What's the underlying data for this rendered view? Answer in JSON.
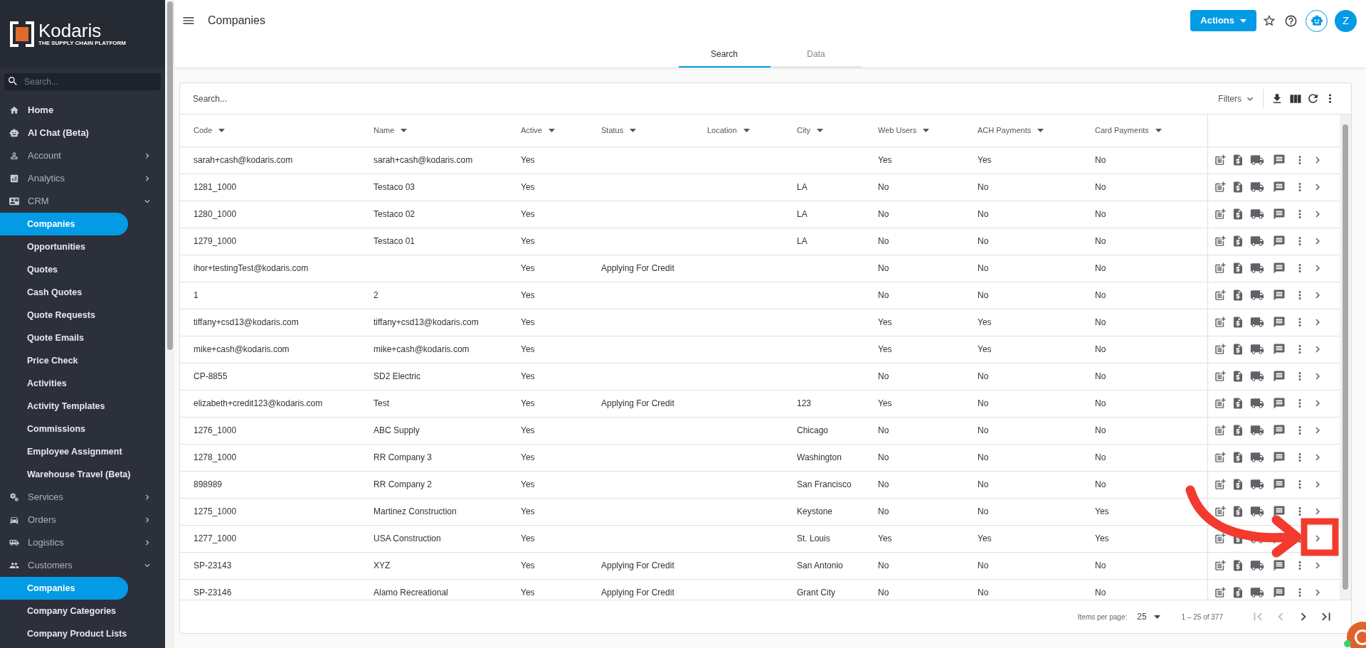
{
  "logo": {
    "name": "Kodaris",
    "tagline": "THE SUPPLY CHAIN PLATFORM"
  },
  "sidebar": {
    "search_placeholder": "Search...",
    "items": [
      {
        "kind": "link",
        "label": "Home"
      },
      {
        "kind": "link",
        "label": "AI Chat (Beta)"
      },
      {
        "kind": "group",
        "label": "Account",
        "expanded": false
      },
      {
        "kind": "group",
        "label": "Analytics",
        "expanded": false
      },
      {
        "kind": "group",
        "label": "CRM",
        "expanded": true,
        "children": [
          {
            "label": "Companies",
            "selected": true
          },
          {
            "label": "Opportunities",
            "selected": false
          },
          {
            "label": "Quotes",
            "selected": false
          },
          {
            "label": "Cash Quotes",
            "selected": false
          },
          {
            "label": "Quote Requests",
            "selected": false
          },
          {
            "label": "Quote Emails",
            "selected": false
          },
          {
            "label": "Price Check",
            "selected": false
          },
          {
            "label": "Activities",
            "selected": false
          },
          {
            "label": "Activity Templates",
            "selected": false
          },
          {
            "label": "Commissions",
            "selected": false
          },
          {
            "label": "Employee Assignment",
            "selected": false
          },
          {
            "label": "Warehouse Travel (Beta)",
            "selected": false
          }
        ]
      },
      {
        "kind": "group",
        "label": "Services",
        "expanded": false
      },
      {
        "kind": "group",
        "label": "Orders",
        "expanded": false
      },
      {
        "kind": "group",
        "label": "Logistics",
        "expanded": false
      },
      {
        "kind": "group",
        "label": "Customers",
        "expanded": true,
        "children": [
          {
            "label": "Companies",
            "selected": true
          },
          {
            "label": "Company Categories",
            "selected": false
          },
          {
            "label": "Company Product Lists",
            "selected": false
          }
        ]
      }
    ]
  },
  "header": {
    "title": "Companies",
    "actions_button": "Actions",
    "avatar": "Z"
  },
  "tabs": [
    {
      "label": "Search",
      "selected": true
    },
    {
      "label": "Data",
      "selected": false
    }
  ],
  "table": {
    "search_placeholder": "Search...",
    "filters": "Filters",
    "columns": [
      "Code",
      "Name",
      "Active",
      "Status",
      "Location",
      "City",
      "Web Users",
      "ACH Payments",
      "Card Payments"
    ],
    "rows": [
      [
        "sarah+cash@kodaris.com",
        "sarah+cash@kodaris.com",
        "Yes",
        "",
        "",
        "",
        "Yes",
        "Yes",
        "No"
      ],
      [
        "1281_1000",
        "Testaco 03",
        "Yes",
        "",
        "",
        "LA",
        "No",
        "No",
        "No"
      ],
      [
        "1280_1000",
        "Testaco 02",
        "Yes",
        "",
        "",
        "LA",
        "No",
        "No",
        "No"
      ],
      [
        "1279_1000",
        "Testaco 01",
        "Yes",
        "",
        "",
        "LA",
        "No",
        "No",
        "No"
      ],
      [
        "ihor+testingTest@kodaris.com",
        "",
        "Yes",
        "Applying For Credit",
        "",
        "",
        "No",
        "No",
        "No"
      ],
      [
        "1",
        "2",
        "Yes",
        "",
        "",
        "",
        "No",
        "No",
        "No"
      ],
      [
        "tiffany+csd13@kodaris.com",
        "tiffany+csd13@kodaris.com",
        "Yes",
        "",
        "",
        "",
        "Yes",
        "Yes",
        "No"
      ],
      [
        "mike+cash@kodaris.com",
        "mike+cash@kodaris.com",
        "Yes",
        "",
        "",
        "",
        "Yes",
        "Yes",
        "No"
      ],
      [
        "CP-8855",
        "SD2 Electric",
        "Yes",
        "",
        "",
        "",
        "No",
        "No",
        "No"
      ],
      [
        "elizabeth+credit123@kodaris.com",
        "Test",
        "Yes",
        "Applying For Credit",
        "",
        "123",
        "Yes",
        "No",
        "No"
      ],
      [
        "1276_1000",
        "ABC Supply",
        "Yes",
        "",
        "",
        "Chicago",
        "No",
        "No",
        "No"
      ],
      [
        "1278_1000",
        "RR Company 3",
        "Yes",
        "",
        "",
        "Washington",
        "No",
        "No",
        "No"
      ],
      [
        "898989",
        "RR Company 2",
        "Yes",
        "",
        "",
        "San Francisco",
        "No",
        "No",
        "No"
      ],
      [
        "1275_1000",
        "Martinez Construction",
        "Yes",
        "",
        "",
        "Keystone",
        "No",
        "No",
        "Yes"
      ],
      [
        "1277_1000",
        "USA Construction",
        "Yes",
        "",
        "",
        "St. Louis",
        "Yes",
        "Yes",
        "Yes"
      ],
      [
        "SP-23143",
        "XYZ",
        "Yes",
        "Applying For Credit",
        "",
        "San Antonio",
        "No",
        "No",
        "No"
      ],
      [
        "SP-23146",
        "Alamo Recreational",
        "Yes",
        "Applying For Credit",
        "",
        "Grant City",
        "No",
        "No",
        "No"
      ]
    ]
  },
  "pagination": {
    "items_per_page_label": "Items per page:",
    "page_size": "25",
    "range": "1 – 25 of 377"
  }
}
